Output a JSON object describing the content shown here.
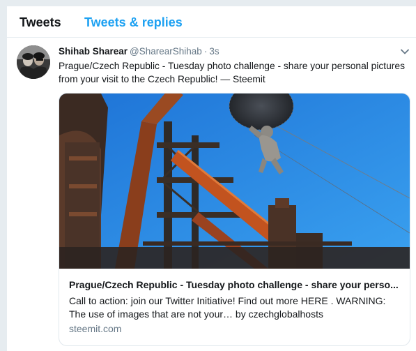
{
  "tabs": [
    {
      "label": "Tweets",
      "active": true
    },
    {
      "label": "Tweets & replies",
      "active": false
    }
  ],
  "tweet": {
    "author_name": "Shihab Sharear",
    "author_handle": "@SharearShihab",
    "separator": "·",
    "time": "3s",
    "text": "Prague/Czech Republic - Tuesday photo challenge - share your personal pictures from your visit to the Czech Republic! — Steemit",
    "link_card": {
      "title": "Prague/Czech Republic - Tuesday photo challenge - share your perso...",
      "description": "Call to action: join our Twitter Initiative! Find out more HERE . WARNING: The use of images that are not your… by czechglobalhosts",
      "domain": "steemit.com"
    }
  },
  "icons": {
    "caret": "chevron-down-icon"
  },
  "colors": {
    "accent": "#1da1f2",
    "text_primary": "#14171a",
    "text_secondary": "#657786",
    "background": "#e6ecf0",
    "sky": "#2f8fe6",
    "rust": "#a4471f"
  }
}
